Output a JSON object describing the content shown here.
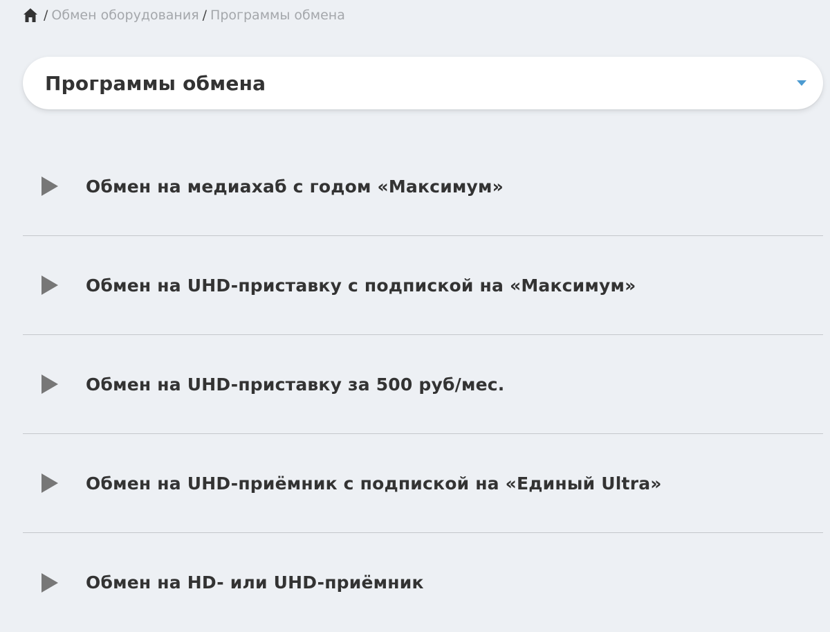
{
  "breadcrumb": {
    "home_icon": "home-icon",
    "separator": "/",
    "items": [
      {
        "label": "Обмен оборудования"
      },
      {
        "label": "Программы обмена"
      }
    ]
  },
  "dropdown": {
    "selected": "Программы обмена",
    "caret_icon": "chevron-down-icon",
    "caret_color": "#4c9bd1"
  },
  "programs": {
    "arrow_icon": "play-triangle-icon",
    "items": [
      {
        "title": "Обмен на медиахаб с годом «Максимум»"
      },
      {
        "title": "Обмен на UHD-приставку с подпиской на «Максимум»"
      },
      {
        "title": "Обмен на UHD-приставку за 500 руб/мес."
      },
      {
        "title": "Обмен на UHD-приёмник с подпиской на «Единый Ultra»"
      },
      {
        "title": "Обмен на HD- или UHD-приёмник"
      }
    ]
  },
  "colors": {
    "background": "#edf0f4",
    "text": "#333333",
    "breadcrumb_text": "#a4a7ab",
    "divider": "#c4c7cb",
    "arrow": "#777777"
  }
}
